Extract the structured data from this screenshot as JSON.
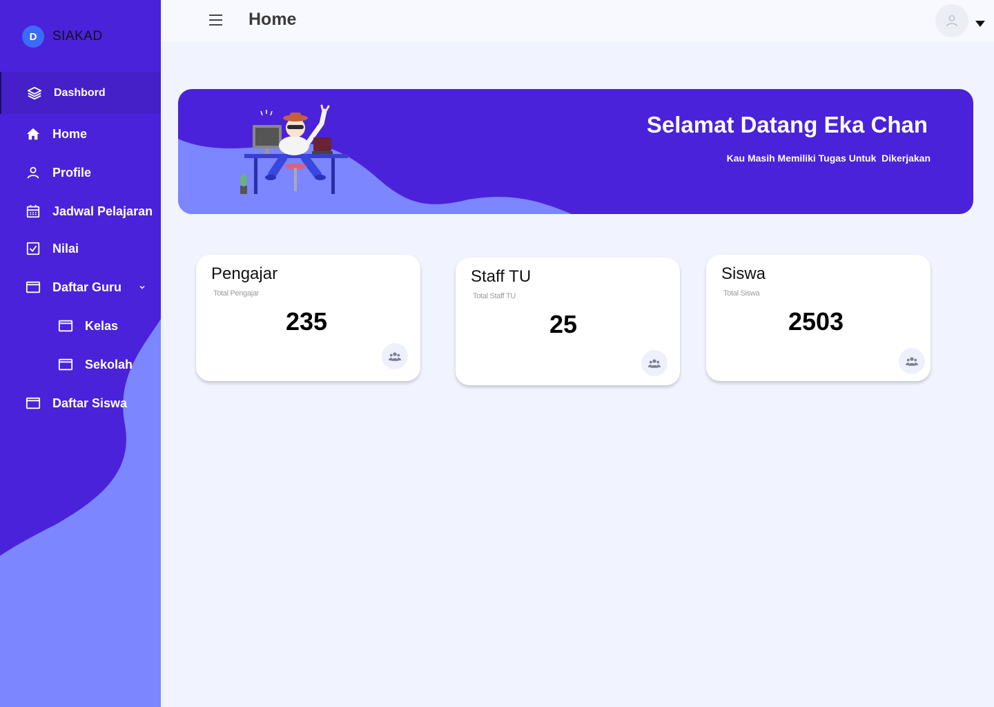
{
  "brand": {
    "logo_letter": "D",
    "name": "SIAKAD"
  },
  "sidebar": {
    "items": [
      {
        "label": "Dashbord",
        "icon": "layers-icon",
        "active": true
      },
      {
        "label": "Home",
        "icon": "home-icon"
      },
      {
        "label": "Profile",
        "icon": "user-icon"
      },
      {
        "label": "Jadwal Pelajaran",
        "icon": "calendar-icon"
      },
      {
        "label": "Nilai",
        "icon": "checkbox-icon"
      },
      {
        "label": "Daftar Guru",
        "icon": "window-icon",
        "expanded": true
      },
      {
        "label": "Kelas",
        "icon": "window-icon"
      },
      {
        "label": "Sekolah",
        "icon": "window-icon"
      },
      {
        "label": "Daftar Siswa",
        "icon": "window-icon"
      }
    ]
  },
  "header": {
    "title": "Home",
    "menu_icon": "hamburger-icon",
    "avatar_icon": "user-avatar-icon"
  },
  "banner": {
    "title": "Selamat Datang Eka Chan",
    "subtitle": "Kau Masih Memiliki Tugas Untuk  Dikerjakan"
  },
  "cards": [
    {
      "title": "Pengajar",
      "subtitle": "Total Pengajar",
      "value": "235",
      "icon": "users-icon"
    },
    {
      "title": "Staff TU",
      "subtitle": "Total Staff TU",
      "value": "25",
      "icon": "users-icon"
    },
    {
      "title": "Siswa",
      "subtitle": "Total Siswa",
      "value": "2503",
      "icon": "users-icon"
    }
  ],
  "colors": {
    "primary": "#4a22d9",
    "wave": "#7b86ff",
    "background": "#f1f3fe"
  }
}
